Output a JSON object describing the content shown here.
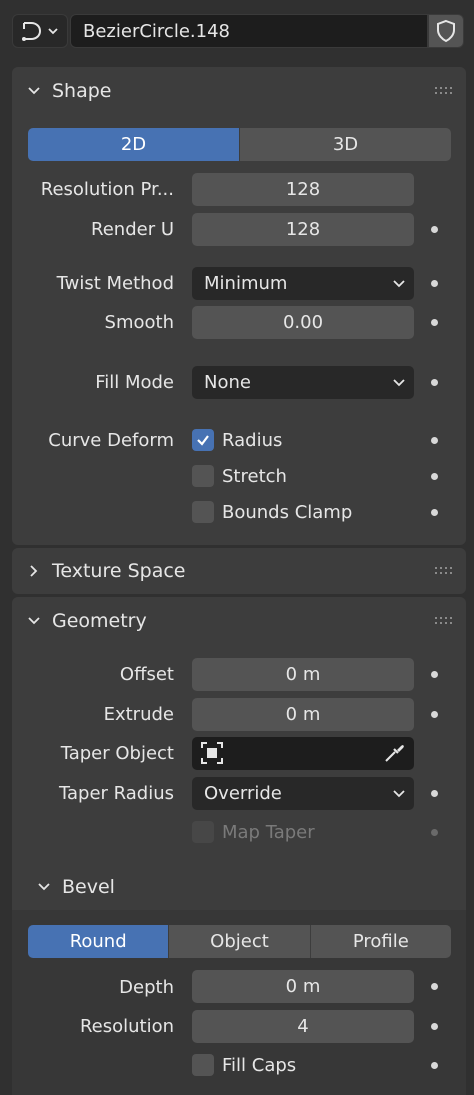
{
  "header": {
    "object_name": "BezierCircle.148",
    "type_icon": "curve-icon",
    "fake_user_icon": "shield-icon"
  },
  "shape": {
    "title": "Shape",
    "dimensions": [
      "2D",
      "3D"
    ],
    "dimensions_active": "2D",
    "resolution_preview_label": "Resolution Pr...",
    "resolution_preview_value": "128",
    "render_u_label": "Render U",
    "render_u_value": "128",
    "twist_method_label": "Twist Method",
    "twist_method_value": "Minimum",
    "smooth_label": "Smooth",
    "smooth_value": "0.00",
    "fill_mode_label": "Fill Mode",
    "fill_mode_value": "None",
    "curve_deform_label": "Curve Deform",
    "radius_label": "Radius",
    "radius_checked": true,
    "stretch_label": "Stretch",
    "stretch_checked": false,
    "bounds_clamp_label": "Bounds Clamp",
    "bounds_clamp_checked": false
  },
  "texture_space": {
    "title": "Texture Space"
  },
  "geometry": {
    "title": "Geometry",
    "offset_label": "Offset",
    "offset_value": "0 m",
    "extrude_label": "Extrude",
    "extrude_value": "0 m",
    "taper_object_label": "Taper Object",
    "taper_object_value": "",
    "taper_radius_label": "Taper Radius",
    "taper_radius_value": "Override",
    "map_taper_label": "Map Taper",
    "map_taper_checked": false
  },
  "bevel": {
    "title": "Bevel",
    "modes": [
      "Round",
      "Object",
      "Profile"
    ],
    "mode_active": "Round",
    "depth_label": "Depth",
    "depth_value": "0 m",
    "resolution_label": "Resolution",
    "resolution_value": "4",
    "fill_caps_label": "Fill Caps",
    "fill_caps_checked": false
  },
  "colors": {
    "accent": "#4772b3",
    "panel": "#3d3d3d",
    "background": "#303030",
    "field": "#545454",
    "dropdown": "#282828"
  }
}
